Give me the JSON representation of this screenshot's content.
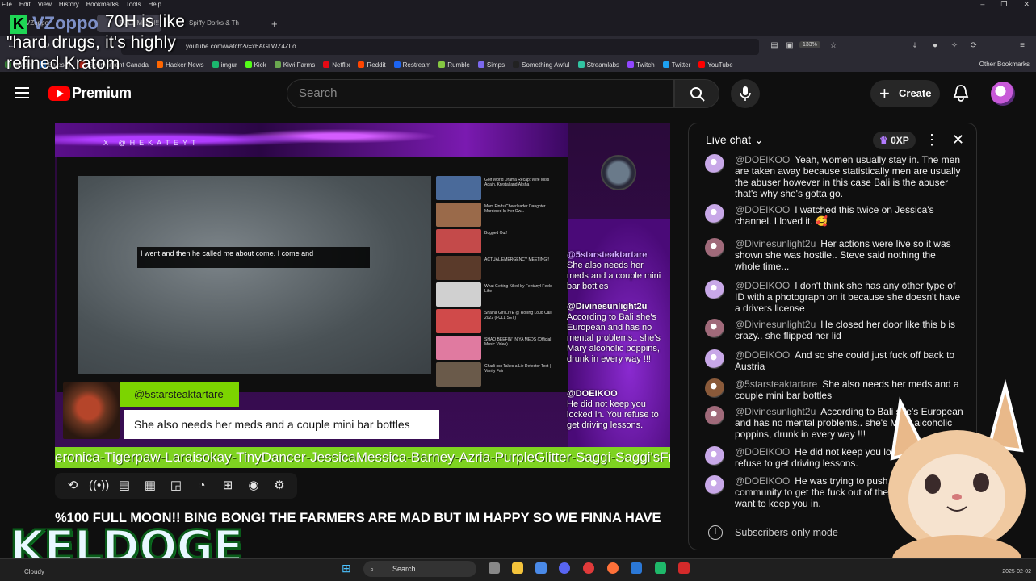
{
  "browser": {
    "menu": [
      "File",
      "Edit",
      "View",
      "History",
      "Bookmarks",
      "Tools",
      "Help"
    ],
    "tabs": [
      {
        "label": "VZoppo"
      },
      {
        "label": "FULL M0ON!! BING"
      },
      {
        "label": "Spiffy Dorks & Th"
      }
    ],
    "url": "youtube.com/watch?v=x6AGLWZ4ZLo",
    "zoom": "133%",
    "bookmarks": [
      {
        "label": "4chan",
        "color": "#3a8a3a"
      },
      {
        "label": "Bluesky",
        "color": "#1185fe"
      },
      {
        "label": "Environment Canada",
        "color": "#d52b1e"
      },
      {
        "label": "Hacker News",
        "color": "#ff6600"
      },
      {
        "label": "imgur",
        "color": "#1bb76e"
      },
      {
        "label": "Kick",
        "color": "#53fc18"
      },
      {
        "label": "Kiwi Farms",
        "color": "#6aa84f"
      },
      {
        "label": "Netflix",
        "color": "#e50914"
      },
      {
        "label": "Reddit",
        "color": "#ff4500"
      },
      {
        "label": "Restream",
        "color": "#1c64f2"
      },
      {
        "label": "Rumble",
        "color": "#85c742"
      },
      {
        "label": "Simps",
        "color": "#7b68ee"
      },
      {
        "label": "Something Awful",
        "color": "#222222"
      },
      {
        "label": "Streamlabs",
        "color": "#31c3a2"
      },
      {
        "label": "Twitch",
        "color": "#9146ff"
      },
      {
        "label": "Twitter",
        "color": "#1da1f2"
      },
      {
        "label": "YouTube",
        "color": "#ff0000"
      }
    ],
    "other_bookmarks": "Other Bookmarks"
  },
  "overlay": {
    "brand": "VZoppo",
    "title": "70H is like \"hard drugs, it's highly refined Kratom"
  },
  "header": {
    "premium_label": "Premium",
    "search_placeholder": "Search",
    "create_label": "Create"
  },
  "video": {
    "banner_text": "X @HEKATEYT",
    "subtitle": "I went and then he called me about come. I come and",
    "side_thumbs": [
      {
        "title": "Golf World Drama Recap: Wife Miss Again, Krystal and Alisha",
        "color": "#4a6a9a"
      },
      {
        "title": "Mom Finds Cheerleader Daughter Murdered In Her Ow...",
        "color": "#9a6a4a"
      },
      {
        "title": "Bugged Out!",
        "color": "#c44a4a"
      },
      {
        "title": "ACTUAL EMERGENCY MEETING!!",
        "color": "#5a3a2a"
      },
      {
        "title": "What Getting Killed by Fentanyl Feels Like",
        "color": "#d0d0d0"
      },
      {
        "title": "Shaina Girl LIVE @ Rolling Loud Cali 2022 (FULL SET)",
        "color": "#d04a4a"
      },
      {
        "title": "SHAQ BEEFIN' IN YA MEDS (Official Music Video)",
        "color": "#e07aa0"
      },
      {
        "title": "Charli xcx Takes a Lie Detector Test | Vanity Fair",
        "color": "#6a5a4a"
      }
    ],
    "side_messages": [
      {
        "author": "@5starsteaktartare",
        "text": "She also needs her meds and a couple mini bar bottles"
      },
      {
        "author": "@Divinesunlight2u",
        "text": "According to Bali she's European and has no mental problems.. she's Mary alcoholic poppins, drunk in every way !!!"
      },
      {
        "author": "@DOEIKOO",
        "text": "He did not keep you locked in. You refuse to get driving lessons."
      }
    ],
    "alert_name": "@5starsteaktartare",
    "alert_message": "She also needs her meds and a couple mini bar bottles",
    "ticker": "eronica-Tigerpaw-Laraisokay-TinyDancer-JessicaMessica-Barney-Azria-PurpleGlitter-Saggi-Saggi'sFriend -",
    "title": "%100 FULL MOON!! BING BONG! THE FARMERS ARE MAD BUT IM HAPPY SO WE FINNA HAVE"
  },
  "controls": [
    "loop-icon",
    "broadcast-icon",
    "captions-settings-icon",
    "clapperboard-icon",
    "picture-in-picture-icon",
    "speedometer-icon",
    "add-screen-icon",
    "camera-icon",
    "gear-icon"
  ],
  "keldoge": "KELDOGE",
  "chat": {
    "title": "Live chat",
    "xp": "0XP",
    "messages": [
      {
        "author": "@DOEIKOO",
        "text": "Yeah, women usually stay in. The men are taken away because statistically men are usually the abuser however in this case Bali is the abuser that's why she's gotta go.",
        "avatar": "#c8a8e8"
      },
      {
        "author": "@DOEIKOO",
        "text": "I watched this twice on Jessica's channel. I loved it. 🥰",
        "avatar": "#c8a8e8"
      },
      {
        "author": "@Divinesunlight2u",
        "text": "Her actions were live so it was shown she was hostile.. Steve said nothing the whole time...",
        "avatar": "#a06a7a"
      },
      {
        "author": "@DOEIKOO",
        "text": "I don't think she has any other type of ID with a photograph on it because she doesn't have a drivers license",
        "avatar": "#c8a8e8"
      },
      {
        "author": "@Divinesunlight2u",
        "text": "He closed her door like this b is crazy.. she flipped her lid",
        "avatar": "#a06a7a"
      },
      {
        "author": "@DOEIKOO",
        "text": "And so she could just fuck off back to Austria",
        "avatar": "#c8a8e8"
      },
      {
        "author": "@5starsteaktartare",
        "text": "She also needs her meds and a couple mini bar bottles",
        "avatar": "#8a5a3a"
      },
      {
        "author": "@Divinesunlight2u",
        "text": "According to Bali she's European and has no mental problems.. she's Mary alcoholic poppins, drunk in every way !!!",
        "avatar": "#a06a7a"
      },
      {
        "author": "@DOEIKOO",
        "text": "He did not keep you locked in. You refuse to get driving lessons.",
        "avatar": "#c8a8e8"
      },
      {
        "author": "@DOEIKOO",
        "text": "He was trying to push her out of the community to get the fuck out of there. He didn't want to keep you in.",
        "avatar": "#c8a8e8"
      }
    ],
    "subscribers_only": "Subscribers-only mode"
  },
  "taskbar": {
    "weather": "Cloudy",
    "search": "Search",
    "date": "2025-02-02"
  }
}
